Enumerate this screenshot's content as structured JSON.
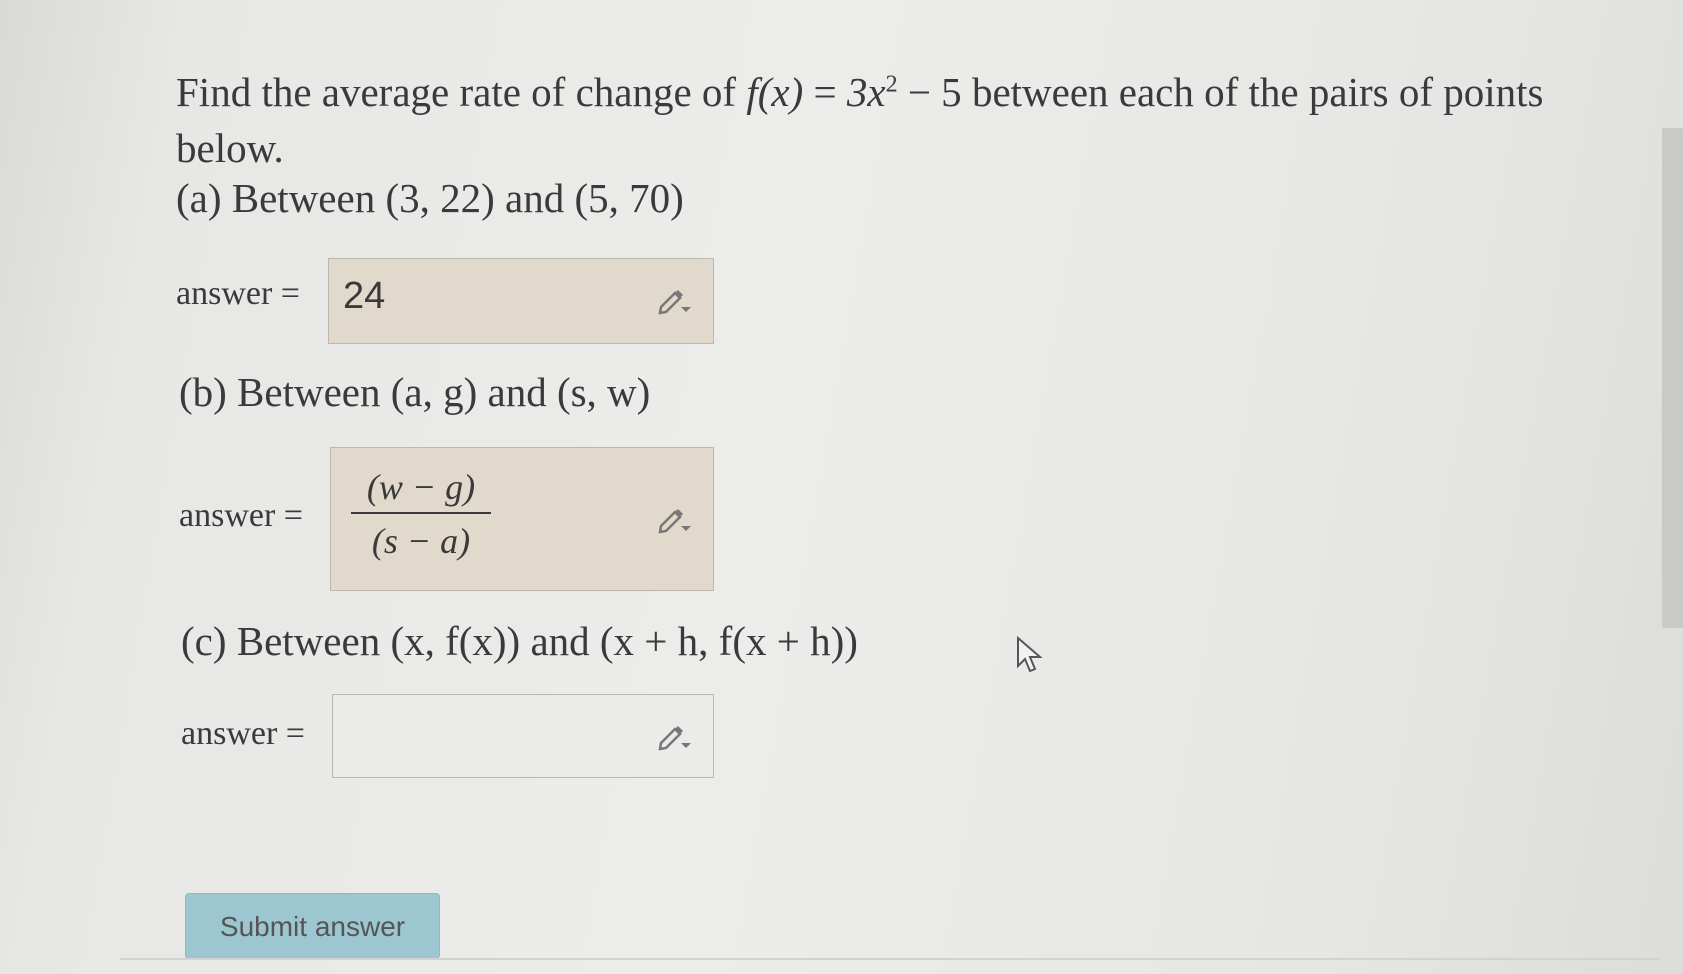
{
  "question": {
    "intro": "Find the average rate of change of",
    "function_lhs": "f(x)",
    "function_rhs_base": "3x",
    "function_rhs_exponent": "2",
    "function_rhs_tail": "− 5",
    "outro": "between each of the pairs of points below."
  },
  "parts": [
    {
      "label": "(a) Between (3, 22) and (5, 70)",
      "answer_label": "answer =",
      "answer_value": "24"
    },
    {
      "label": "(b) Between (a, g) and (s, w)",
      "answer_label": "answer =",
      "answer_numerator": "(w − g)",
      "answer_denominator": "(s − a)"
    },
    {
      "label": "(c) Between (x,  f(x)) and (x + h,  f(x + h))",
      "answer_label": "answer =",
      "answer_value": ""
    }
  ],
  "submit_label": "Submit answer",
  "icons": {
    "editor": "pencil-dropdown-icon",
    "cursor": "mouse-cursor-icon"
  },
  "colors": {
    "filled_answer_bg": "#e2d9cd",
    "submit_bg": "#9cc7d1"
  }
}
